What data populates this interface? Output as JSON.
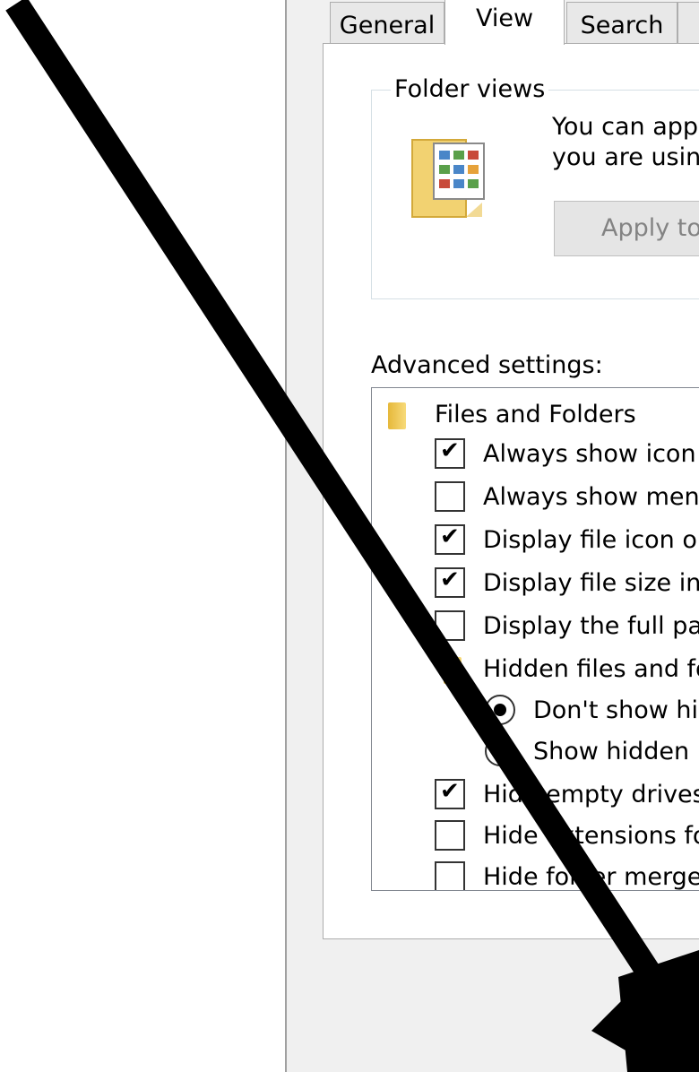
{
  "tabs": [
    {
      "label": "General"
    },
    {
      "label": "View"
    },
    {
      "label": "Search"
    }
  ],
  "folder_views": {
    "group_label": "Folder views",
    "description_line1": "You can app",
    "description_line2": "you are usin",
    "apply_button_label": "Apply to"
  },
  "advanced": {
    "label": "Advanced settings:",
    "items": [
      {
        "type": "folder",
        "label": "Files and Folders"
      },
      {
        "type": "checkbox",
        "checked": true,
        "label": "Always show icon"
      },
      {
        "type": "checkbox",
        "checked": false,
        "label": "Always show men"
      },
      {
        "type": "checkbox",
        "checked": true,
        "label": "Display file icon or"
      },
      {
        "type": "checkbox",
        "checked": true,
        "label": "Display file size inf"
      },
      {
        "type": "checkbox",
        "checked": false,
        "label": "Display the full pat"
      },
      {
        "type": "folder",
        "label": "Hidden files and fo"
      },
      {
        "type": "radio",
        "selected": true,
        "label": "Don't show hid"
      },
      {
        "type": "radio",
        "selected": false,
        "label": "Show hidden"
      },
      {
        "type": "checkbox",
        "checked": true,
        "label": "Hide empty drives"
      },
      {
        "type": "checkbox",
        "checked": false,
        "label": "Hide extensions fo"
      },
      {
        "type": "checkbox",
        "checked": false,
        "label": "Hide folder merge"
      }
    ]
  },
  "colors": {
    "panel_bg": "#ffffff",
    "dialog_bg": "#f0f0f0",
    "arrow": "#000000"
  }
}
